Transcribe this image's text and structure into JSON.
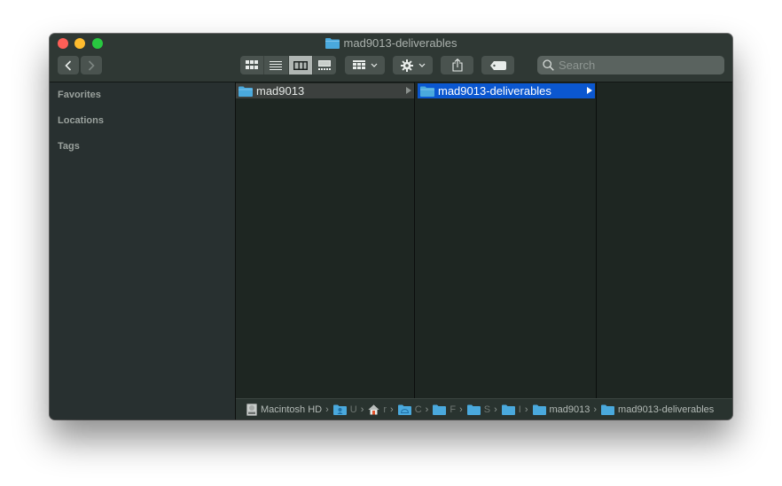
{
  "window": {
    "title": "mad9013-deliverables",
    "title_icon": "folder-icon"
  },
  "toolbar": {
    "back_label": "‹",
    "forward_label": "›",
    "view_modes": [
      {
        "name": "icon-view",
        "active": false
      },
      {
        "name": "list-view",
        "active": false
      },
      {
        "name": "column-view",
        "active": true
      },
      {
        "name": "gallery-view",
        "active": false
      }
    ],
    "group_by_icon": "group-icon",
    "action_icon": "gear-icon",
    "share_icon": "share-icon",
    "tag_icon": "tag-icon",
    "search_placeholder": "Search",
    "search_value": ""
  },
  "sidebar": {
    "sections": [
      {
        "label": "Favorites"
      },
      {
        "label": "Locations"
      },
      {
        "label": "Tags"
      }
    ]
  },
  "columns": [
    {
      "items": [
        {
          "name": "mad9013",
          "selected": true,
          "active": false,
          "has_children": true
        }
      ]
    },
    {
      "items": [
        {
          "name": "mad9013-deliverables",
          "selected": true,
          "active": true,
          "has_children": true
        }
      ]
    },
    {
      "items": []
    }
  ],
  "colors": {
    "selection_active": "#0b57d0",
    "selection_inactive": "#3c403e",
    "folder": "#4aa9dd"
  },
  "pathbar": {
    "items": [
      {
        "label": "Macintosh HD",
        "icon": "hard-drive-icon"
      },
      {
        "label": "U",
        "icon": "user-folder-icon"
      },
      {
        "label": "r",
        "icon": "home-icon"
      },
      {
        "label": "C",
        "icon": "icloud-folder-icon"
      },
      {
        "label": "F",
        "icon": "folder-icon"
      },
      {
        "label": "S",
        "icon": "folder-icon"
      },
      {
        "label": "I",
        "icon": "folder-icon"
      },
      {
        "label": "mad9013",
        "icon": "folder-icon"
      },
      {
        "label": "mad9013-deliverables",
        "icon": "folder-icon"
      }
    ],
    "separator": "›"
  }
}
